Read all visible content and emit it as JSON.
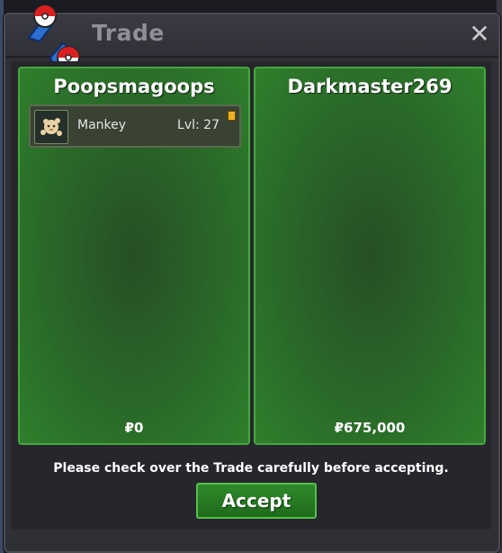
{
  "window": {
    "title": "Trade",
    "close_label": "✕"
  },
  "trade": {
    "left": {
      "owner": "Poopsmagoops",
      "items": [
        {
          "name": "Mankey",
          "level": "Lvl: 27"
        }
      ],
      "money": "₽0"
    },
    "right": {
      "owner": "Darkmaster269",
      "items": [],
      "money": "₽675,000"
    }
  },
  "notice": "Please check over the Trade carefully before accepting.",
  "accept_label": "Accept"
}
